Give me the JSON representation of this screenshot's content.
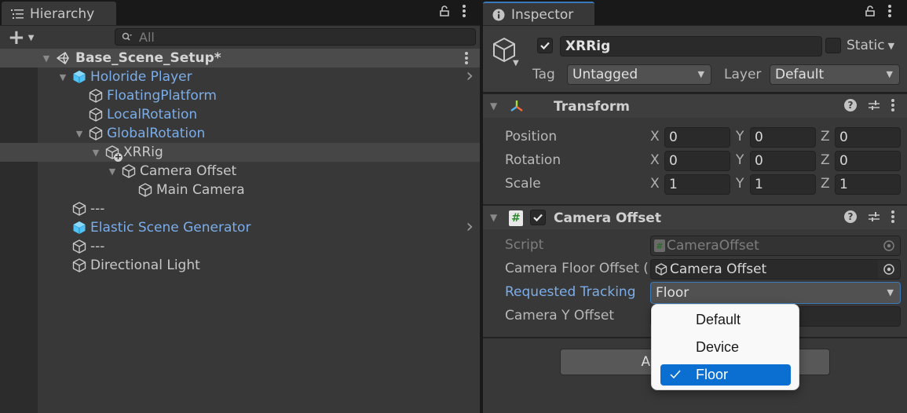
{
  "hierarchy": {
    "tab_label": "Hierarchy",
    "add_button": "+",
    "search_placeholder": "All",
    "scene": {
      "name": "Base_Scene_Setup*"
    },
    "items": [
      {
        "label": "Holoride Player",
        "depth": 1,
        "expanded": true,
        "prefab": true,
        "color": "blue",
        "has_children_arrow": true
      },
      {
        "label": "FloatingPlatform",
        "depth": 2,
        "color": "blue"
      },
      {
        "label": "LocalRotation",
        "depth": 2,
        "color": "blue"
      },
      {
        "label": "GlobalRotation",
        "depth": 2,
        "expanded": true,
        "color": "blue"
      },
      {
        "label": "XRRig",
        "depth": 3,
        "expanded": true,
        "color": "white",
        "selected": true,
        "added_override": true
      },
      {
        "label": "Camera Offset",
        "depth": 4,
        "expanded": true,
        "color": "white"
      },
      {
        "label": "Main Camera",
        "depth": 5,
        "color": "white"
      },
      {
        "label": "---",
        "depth": 1,
        "color": "white"
      },
      {
        "label": "Elastic Scene Generator",
        "depth": 1,
        "prefab": true,
        "color": "blue",
        "has_children_arrow": true
      },
      {
        "label": "---",
        "depth": 1,
        "color": "white"
      },
      {
        "label": "Directional Light",
        "depth": 1,
        "color": "white"
      }
    ]
  },
  "inspector": {
    "tab_label": "Inspector",
    "gameobject": {
      "active": true,
      "name": "XRRig",
      "static_checked": false,
      "static_label": "Static",
      "tag_label": "Tag",
      "tag_value": "Untagged",
      "layer_label": "Layer",
      "layer_value": "Default"
    },
    "transform": {
      "title": "Transform",
      "rows": [
        {
          "label": "Position",
          "x": "0",
          "y": "0",
          "z": "0"
        },
        {
          "label": "Rotation",
          "x": "0",
          "y": "0",
          "z": "0"
        },
        {
          "label": "Scale",
          "x": "1",
          "y": "1",
          "z": "1"
        }
      ],
      "axes": [
        "X",
        "Y",
        "Z"
      ]
    },
    "camera_offset": {
      "title": "Camera Offset",
      "enabled": true,
      "script_label": "Script",
      "script_value": "CameraOffset",
      "floor_offset_label": "Camera Floor Offset (",
      "floor_offset_value": "Camera Offset",
      "requested_tracking_label": "Requested Tracking",
      "requested_tracking_value": "Floor",
      "y_offset_label": "Camera Y Offset"
    },
    "add_component_label": "Add Component"
  },
  "tracking_menu": {
    "options": [
      {
        "label": "Default",
        "selected": false
      },
      {
        "label": "Device",
        "selected": false
      },
      {
        "label": "Floor",
        "selected": true
      }
    ]
  },
  "colors": {
    "accent_blue": "#3a79bb",
    "prefab_blue": "#7bade9",
    "menu_selection": "#0a6fd0"
  }
}
